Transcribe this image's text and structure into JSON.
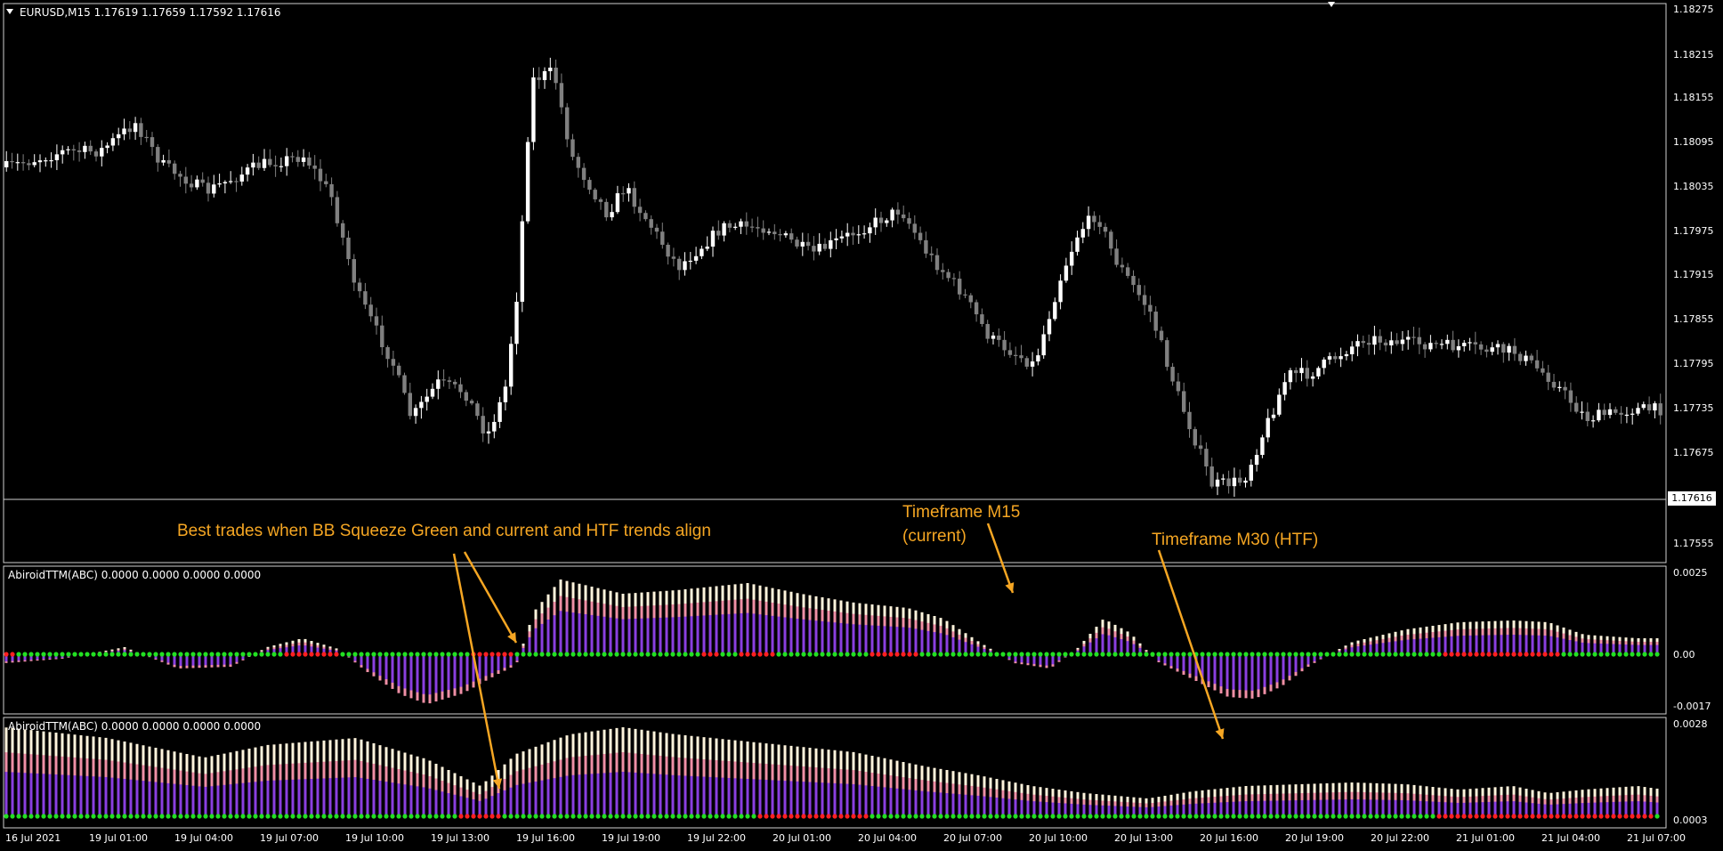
{
  "main_panel": {
    "symbol_info": "EURUSD,M15  1.17619 1.17659 1.17592 1.17616",
    "current_price": "1.17616",
    "price_ticks": [
      "1.18275",
      "1.18215",
      "1.18155",
      "1.18095",
      "1.18035",
      "1.17975",
      "1.17915",
      "1.17855",
      "1.17795",
      "1.17735",
      "1.17675",
      "1.17555"
    ]
  },
  "indicator1": {
    "title": "AbiroidTTM(ABC) 0.0000 0.0000 0.0000 0.0000",
    "ticks": [
      "0.0025",
      "0.00",
      "-0.0017"
    ]
  },
  "indicator2": {
    "title": "AbiroidTTM(ABC) 0.0000 0.0000 0.0000 0.0000",
    "ticks": [
      "0.0028",
      "0.0003"
    ]
  },
  "time_axis": [
    "16 Jul 2021",
    "19 Jul 01:00",
    "19 Jul 04:00",
    "19 Jul 07:00",
    "19 Jul 10:00",
    "19 Jul 13:00",
    "19 Jul 16:00",
    "19 Jul 19:00",
    "19 Jul 22:00",
    "20 Jul 01:00",
    "20 Jul 04:00",
    "20 Jul 07:00",
    "20 Jul 10:00",
    "20 Jul 13:00",
    "20 Jul 16:00",
    "20 Jul 19:00",
    "20 Jul 22:00",
    "21 Jul 01:00",
    "21 Jul 04:00",
    "21 Jul 07:00"
  ],
  "annotations": {
    "best_trades": "Best trades when BB Squeeze Green and current and HTF trends align",
    "m15_line1": "Timeframe M15",
    "m15_line2": "(current)",
    "m30": "Timeframe M30 (HTF)"
  },
  "colors": {
    "background": "#000000",
    "bull_candle": "#ffffff",
    "bear_candle": "#808080",
    "histogram_purple": "#8a3fe0",
    "histogram_pink": "#ef8fa6",
    "histogram_cream": "#fff4dc",
    "squeeze_on": "#ff2020",
    "squeeze_off": "#22e022",
    "annotation": "#f5a623"
  }
}
